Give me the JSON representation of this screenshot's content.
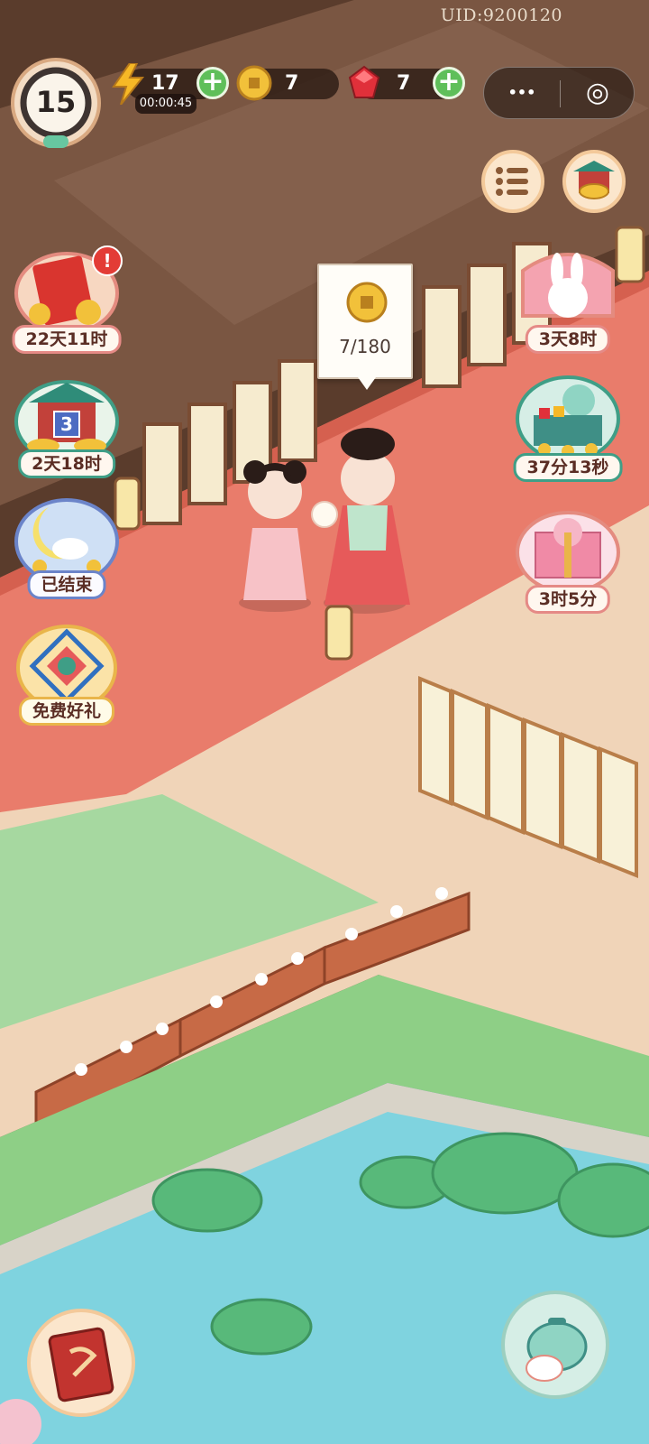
{
  "hud": {
    "uid": "UID:9200120",
    "level": "15",
    "energy": {
      "value": "17",
      "timer": "00:00:45"
    },
    "coins": {
      "value": "7"
    },
    "gems": {
      "value": "7"
    },
    "capsule": {
      "more_glyph": "•••",
      "close_glyph": "◎"
    }
  },
  "tooltip": {
    "progress": "7/180"
  },
  "left_events": [
    {
      "label": "22天11时"
    },
    {
      "label": "2天18时",
      "badge": "3"
    },
    {
      "label": "已结束"
    },
    {
      "label": "免费好礼"
    }
  ],
  "right_events": [
    {
      "label": "3天8时"
    },
    {
      "label": "37分13秒"
    },
    {
      "label": "3时5分"
    }
  ],
  "alert_badge": "!",
  "colors": {
    "carpet": "#e97c6b",
    "green_floor": "#9fd39a",
    "pond": "#7fd3df",
    "plus": "#5fbf5a",
    "gem": "#e0303a",
    "coin": "#f2c13a"
  }
}
